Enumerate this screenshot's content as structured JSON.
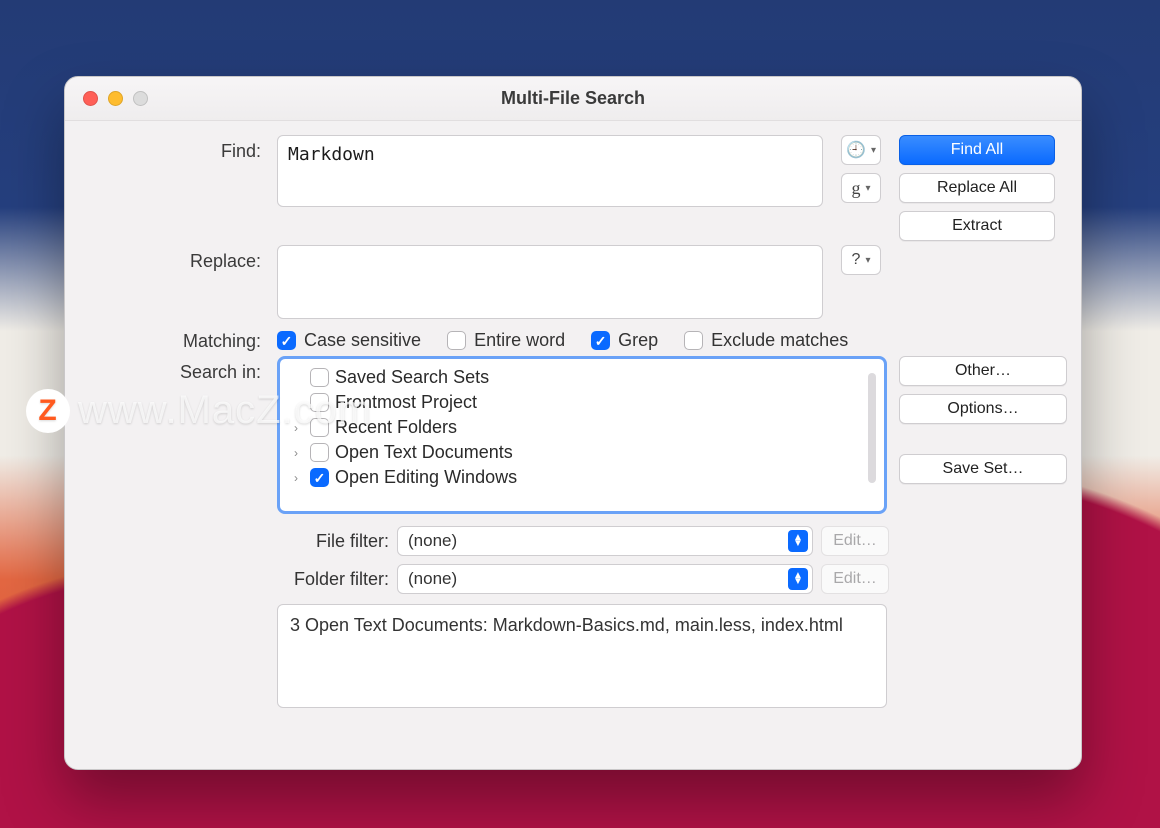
{
  "window": {
    "title": "Multi-File Search"
  },
  "labels": {
    "find": "Find:",
    "replace": "Replace:",
    "matching": "Matching:",
    "search_in": "Search in:",
    "file_filter": "File filter:",
    "folder_filter": "Folder filter:"
  },
  "find": {
    "value": "Markdown"
  },
  "replace": {
    "value": ""
  },
  "matching": {
    "case_sensitive": {
      "label": "Case sensitive",
      "checked": true
    },
    "entire_word": {
      "label": "Entire word",
      "checked": false
    },
    "grep": {
      "label": "Grep",
      "checked": true
    },
    "exclude": {
      "label": "Exclude matches",
      "checked": false
    }
  },
  "search_in": {
    "items": [
      {
        "label": "Saved Search Sets",
        "checked": false,
        "expandable": false
      },
      {
        "label": "Frontmost Project",
        "checked": false,
        "expandable": false
      },
      {
        "label": "Recent Folders",
        "checked": false,
        "expandable": true
      },
      {
        "label": "Open Text Documents",
        "checked": false,
        "expandable": true
      },
      {
        "label": "Open Editing Windows",
        "checked": true,
        "expandable": true
      }
    ]
  },
  "filters": {
    "file": {
      "value": "(none)",
      "edit_label": "Edit…"
    },
    "folder": {
      "value": "(none)",
      "edit_label": "Edit…"
    }
  },
  "summary": "3 Open Text Documents: Markdown-Basics.md, main.less, index.html",
  "buttons": {
    "find_all": "Find All",
    "replace_all": "Replace All",
    "extract": "Extract",
    "other": "Other…",
    "options": "Options…",
    "save_set": "Save Set…"
  },
  "watermark": {
    "badge": "Z",
    "text": "www.MacZ.com"
  }
}
